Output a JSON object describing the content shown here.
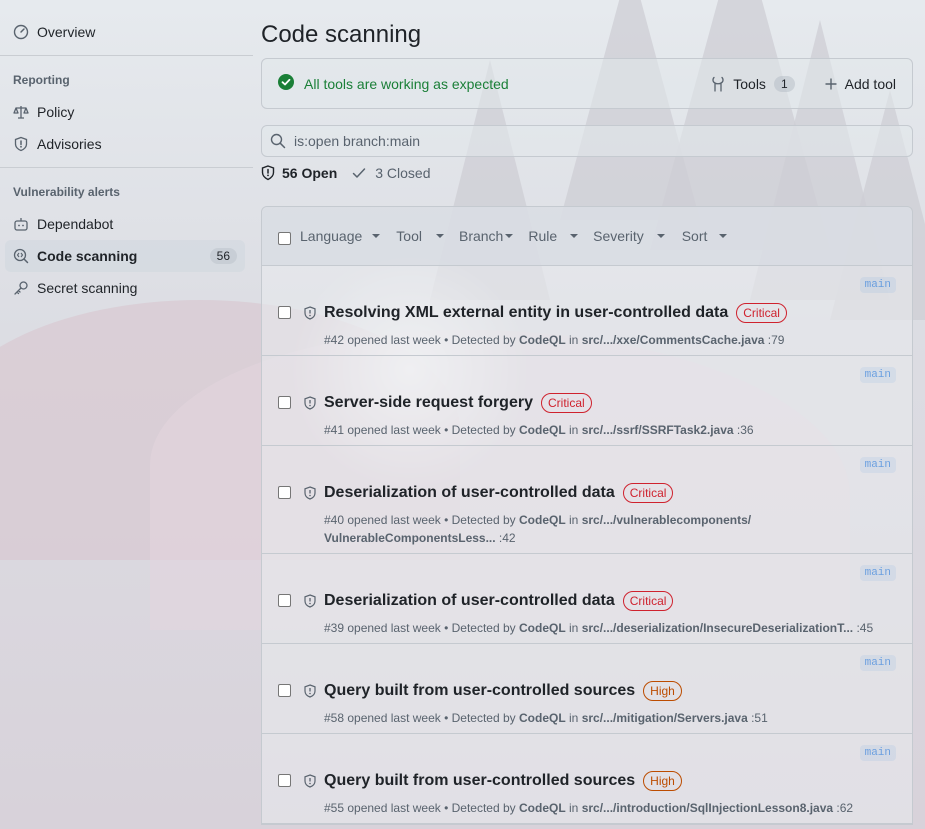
{
  "sidebar": {
    "overview": "Overview",
    "reporting_heading": "Reporting",
    "policy": "Policy",
    "advisories": "Advisories",
    "vuln_heading": "Vulnerability alerts",
    "dependabot": "Dependabot",
    "code_scanning": "Code scanning",
    "code_scanning_count": "56",
    "secret_scanning": "Secret scanning"
  },
  "main": {
    "title": "Code scanning",
    "status_text": "All tools are working as expected",
    "tools_label": "Tools",
    "tools_count": "1",
    "add_tool_label": "Add tool",
    "search_value": "is:open branch:main",
    "open_label": "56 Open",
    "closed_label": "3 Closed",
    "filters": [
      "Language",
      "Tool",
      "Branch",
      "Rule",
      "Severity",
      "Sort"
    ]
  },
  "alerts": [
    {
      "title": "Resolving XML external entity in user-controlled data",
      "severity": "Critical",
      "severity_level": "critical",
      "branch": "main",
      "meta_prefix": "#42 opened last week • Detected by ",
      "tool": "CodeQL",
      "in": " in ",
      "path": "src/.../xxe/CommentsCache.java",
      "line": " :79"
    },
    {
      "title": "Server-side request forgery",
      "severity": "Critical",
      "severity_level": "critical",
      "branch": "main",
      "meta_prefix": "#41 opened last week • Detected by ",
      "tool": "CodeQL",
      "in": " in ",
      "path": "src/.../ssrf/SSRFTask2.java",
      "line": " :36"
    },
    {
      "title": "Deserialization of user-controlled data",
      "severity": "Critical",
      "severity_level": "critical",
      "branch": "main",
      "meta_prefix": "#40 opened last week • Detected by ",
      "tool": "CodeQL",
      "in": " in ",
      "path": "src/.../vulnerablecomponents/ VulnerableComponentsLess...",
      "line": " :42"
    },
    {
      "title": "Deserialization of user-controlled data",
      "severity": "Critical",
      "severity_level": "critical",
      "branch": "main",
      "meta_prefix": "#39 opened last week • Detected by ",
      "tool": "CodeQL",
      "in": " in ",
      "path": "src/.../deserialization/InsecureDeserializationT...",
      "line": " :45"
    },
    {
      "title": "Query built from user-controlled sources",
      "severity": "High",
      "severity_level": "high",
      "branch": "main",
      "meta_prefix": "#58 opened last week • Detected by ",
      "tool": "CodeQL",
      "in": " in ",
      "path": "src/.../mitigation/Servers.java",
      "line": " :51"
    },
    {
      "title": "Query built from user-controlled sources",
      "severity": "High",
      "severity_level": "high",
      "branch": "main",
      "meta_prefix": "#55 opened last week • Detected by ",
      "tool": "CodeQL",
      "in": " in ",
      "path": "src/.../introduction/SqlInjectionLesson8.java",
      "line": " :62"
    }
  ],
  "colors": {
    "success": "#1a7f37",
    "critical": "#cf222e",
    "high": "#bc4c00",
    "muted": "#59636e"
  },
  "icons": {
    "overview": "meter-icon",
    "policy": "law-icon",
    "advisories": "shield-icon",
    "dependabot": "dependabot-icon",
    "code_scanning": "codescan-icon",
    "secret_scanning": "key-icon"
  }
}
